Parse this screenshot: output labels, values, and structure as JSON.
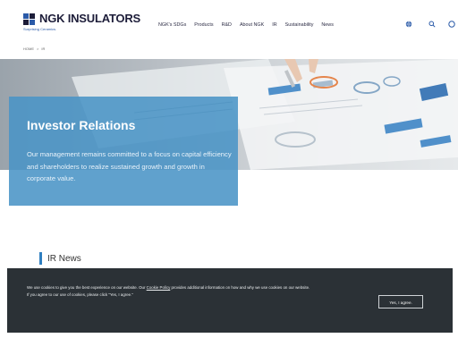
{
  "header": {
    "logo_text": "NGK INSULATORS",
    "tagline": "Surprising Ceramics.",
    "brand_colors": {
      "blue": "#2a5aa8",
      "navy": "#1d1d39"
    }
  },
  "nav": {
    "items": [
      {
        "label": "NGK's SDGs"
      },
      {
        "label": "Products"
      },
      {
        "label": "R&D"
      },
      {
        "label": "About NGK"
      },
      {
        "label": "IR"
      },
      {
        "label": "Sustainability"
      },
      {
        "label": "News"
      }
    ],
    "icons": [
      "globe-icon",
      "search-icon",
      "menu-icon"
    ]
  },
  "breadcrumb": {
    "home": "HOME",
    "separator": ">",
    "current": "IR"
  },
  "hero": {
    "title": "Investor Relations",
    "description": "Our management remains committed to a focus on capital efficiency and shareholders to realize sustained growth and growth in corporate value.",
    "panel_color": "#4a94c6"
  },
  "news": {
    "title": "IR News"
  },
  "cookie": {
    "text_prefix": "We use cookies to give you the best experience on our website. Our ",
    "policy_link": "Cookie Policy",
    "text_suffix": " provides additional information on how and why we use cookies on our website.",
    "text_line2": "If you agree to our use of cookies, please click \"Yes, I agree.\"",
    "button_label": "Yes, I agree.",
    "background": "#2b3136"
  }
}
